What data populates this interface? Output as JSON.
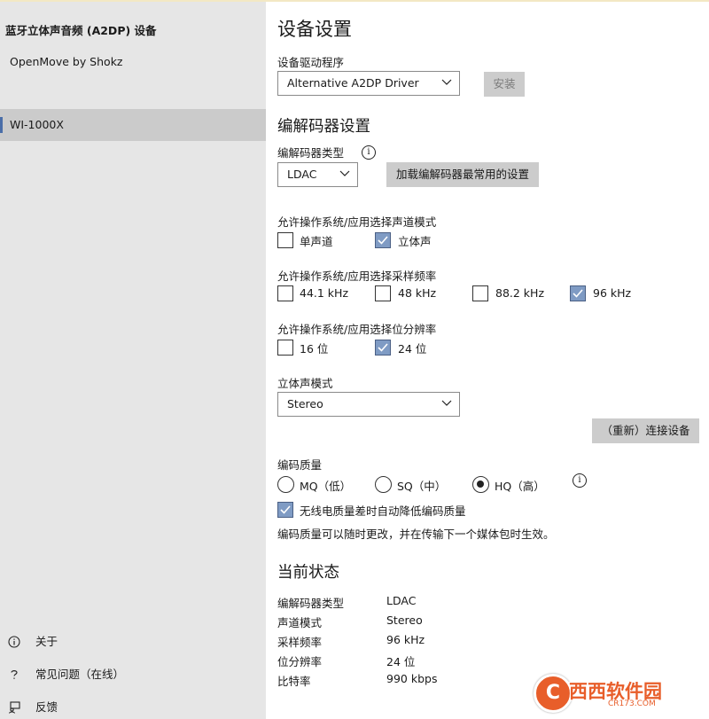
{
  "sidebar": {
    "app_title": "蓝牙立体声音频 (A2DP) 设备",
    "devices": [
      {
        "label": "OpenMove by Shokz"
      },
      {
        "label": "WI-1000X",
        "selected": true
      }
    ],
    "footer": [
      {
        "label": "关于",
        "icon": "info-icon"
      },
      {
        "label": "常见问题（在线）",
        "icon": "question-icon"
      },
      {
        "label": "反馈",
        "icon": "feedback-icon"
      }
    ]
  },
  "device_settings": {
    "title": "设备设置",
    "driver_label": "设备驱动程序",
    "driver_value": "Alternative A2DP Driver",
    "install_button": "安装"
  },
  "codec_settings": {
    "title": "编解码器设置",
    "codec_type_label": "编解码器类型",
    "codec_type_value": "LDAC",
    "load_common_button": "加载编解码器最常用的设置",
    "channel_mode_label": "允许操作系统/应用选择声道模式",
    "channel_modes": [
      {
        "label": "单声道",
        "checked": false
      },
      {
        "label": "立体声",
        "checked": true
      }
    ],
    "sample_rate_label": "允许操作系统/应用选择采样频率",
    "sample_rates": [
      {
        "label": "44.1 kHz",
        "checked": false
      },
      {
        "label": "48 kHz",
        "checked": false
      },
      {
        "label": "88.2 kHz",
        "checked": false
      },
      {
        "label": "96 kHz",
        "checked": true
      }
    ],
    "bit_depth_label": "允许操作系统/应用选择位分辨率",
    "bit_depths": [
      {
        "label": "16 位",
        "checked": false
      },
      {
        "label": "24 位",
        "checked": true
      }
    ],
    "stereo_mode_label": "立体声模式",
    "stereo_mode_value": "Stereo",
    "reconnect_button": "（重新）连接设备",
    "quality_label": "编码质量",
    "qualities": [
      {
        "label": "MQ（低）",
        "selected": false
      },
      {
        "label": "SQ（中）",
        "selected": false
      },
      {
        "label": "HQ（高）",
        "selected": true
      }
    ],
    "auto_lower_label": "无线电质量差时自动降低编码质量",
    "auto_lower_checked": true,
    "note": "编码质量可以随时更改，并在传输下一个媒体包时生效。"
  },
  "current_status": {
    "title": "当前状态",
    "rows": [
      {
        "key": "编解码器类型",
        "value": "LDAC"
      },
      {
        "key": "声道模式",
        "value": "Stereo"
      },
      {
        "key": "采样频率",
        "value": "96 kHz"
      },
      {
        "key": "位分辨率",
        "value": "24 位"
      },
      {
        "key": "比特率",
        "value": "990 kbps"
      }
    ]
  },
  "watermark": {
    "logo_letter": "C",
    "brand": "西西软件园",
    "site": "CR173.COM",
    "color": "#e85e2a"
  },
  "colors": {
    "sidebar_bg": "#e6e6e6",
    "selected_item_bg": "#cbcbcb",
    "accent": "#4a6ea8",
    "checked_box": "#7f9bc4",
    "button_bg": "#cccccc"
  }
}
